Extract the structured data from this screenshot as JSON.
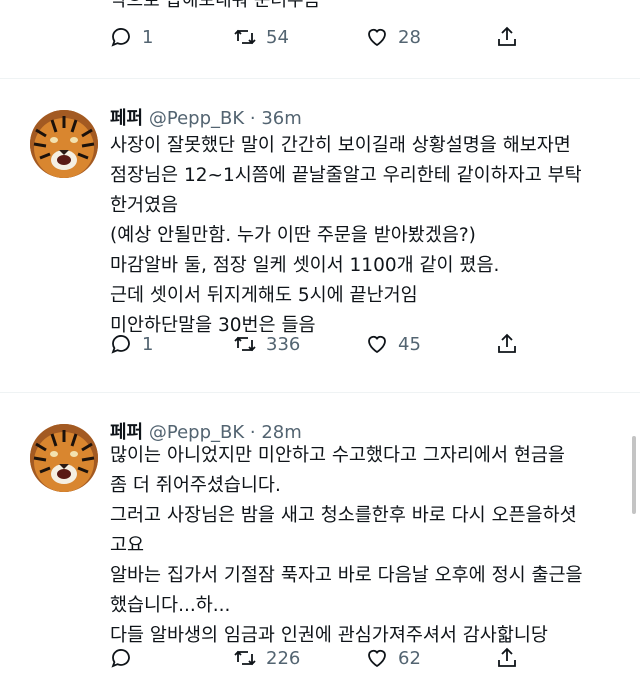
{
  "top_fragment": {
    "text": "딱으로 삽해보내줘 눈러주음",
    "replies": "1",
    "retweets": "54",
    "likes": "28"
  },
  "tweets": [
    {
      "name": "페퍼",
      "handle": "@Pepp_BK",
      "sep": "·",
      "time": "36m",
      "lines": [
        "사장이 잘못했단 말이 간간히 보이길래 상황설명을 해보자면",
        "점장님은 12~1시쯤에 끝날줄알고 우리한테 같이하자고 부탁",
        "한거였음",
        "(예상 안될만함. 누가 이딴 주문을 받아봤겠음?)",
        "마감알바 둘, 점장 일케 셋이서 1100개 같이 폈음.",
        "근데 셋이서 뒤지게해도 5시에 끝난거임",
        "미안하단말을 30번은 들음"
      ],
      "replies": "1",
      "retweets": "336",
      "likes": "45"
    },
    {
      "name": "페퍼",
      "handle": "@Pepp_BK",
      "sep": "·",
      "time": "28m",
      "lines": [
        "많이는 아니었지만 미안하고 수고했다고 그자리에서 현금을",
        "좀 더 쥐어주셨습니다.",
        "그러고 사장님은 밤을 새고 청소를한후 바로 다시 오픈을하셧",
        "고요",
        "알바는 집가서 기절잠 푹자고 바로 다음날 오후에 정시 출근을",
        "했습니다...하...",
        "다들 알바생의 임금과 인권에 관심가져주셔서 감사핣니당"
      ],
      "replies": "",
      "retweets": "226",
      "likes": "62"
    }
  ],
  "colors": {
    "text": "#0f1419",
    "secondary": "#536471",
    "divider": "#eff3f4"
  },
  "icons": [
    "reply-icon",
    "retweet-icon",
    "like-icon",
    "share-icon"
  ]
}
